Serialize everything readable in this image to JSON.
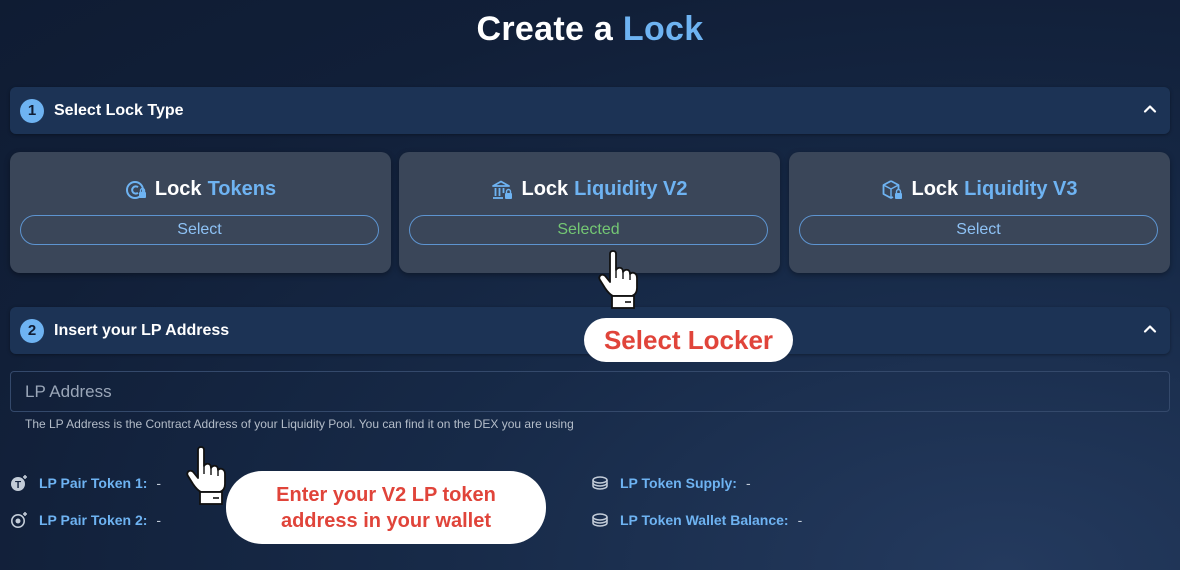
{
  "header": {
    "title_prefix": "Create a",
    "title_accent": "Lock"
  },
  "step1": {
    "number": "1",
    "title": "Select Lock Type"
  },
  "cards": [
    {
      "prefix": "Lock",
      "accent": "Tokens",
      "button": "Select",
      "icon": "token-coin-icon"
    },
    {
      "prefix": "Lock",
      "accent": "Liquidity V2",
      "button": "Selected",
      "icon": "bank-lock-icon"
    },
    {
      "prefix": "Lock",
      "accent": "Liquidity V3",
      "button": "Select",
      "icon": "cube-lock-icon"
    }
  ],
  "step2": {
    "number": "2",
    "title": "Insert your LP Address"
  },
  "lp_input": {
    "placeholder": "LP Address",
    "value": "",
    "helper": "The LP Address is the Contract Address of your Liquidity Pool. You can find it on the DEX you are using"
  },
  "info": {
    "pair_token_1": {
      "label": "LP Pair Token 1:",
      "value": "-"
    },
    "pair_token_2": {
      "label": "LP Pair Token 2:",
      "value": "-"
    },
    "token_supply": {
      "label": "LP Token Supply:",
      "value": "-"
    },
    "wallet_balance": {
      "label": "LP Token Wallet Balance:",
      "value": "-"
    }
  },
  "annotations": {
    "select_locker": "Select Locker",
    "enter_address": "Enter your V2 LP token address in your wallet"
  },
  "colors": {
    "accent": "#6eb3f2",
    "selected": "#74c774",
    "callout_text": "#e0443a",
    "background": "#142440"
  }
}
